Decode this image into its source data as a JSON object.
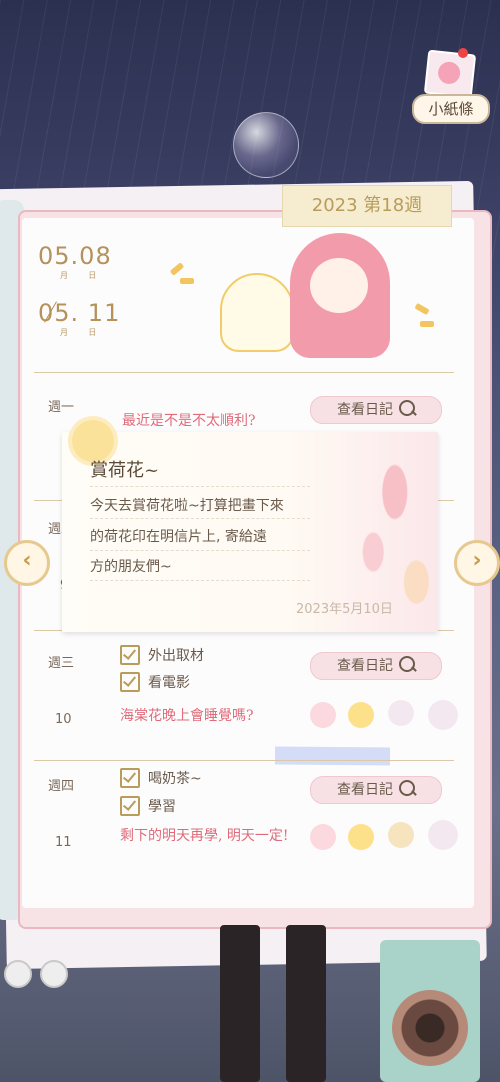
{
  "note_button": {
    "label": "小紙條"
  },
  "week": {
    "label": "2023 第18週"
  },
  "date_range": {
    "start": "05.08",
    "end": "05. 11",
    "start_sub_month": "月",
    "start_sub_day": "日",
    "end_sub_month": "月",
    "end_sub_day": "日"
  },
  "days": [
    {
      "label": "週一",
      "num": "",
      "note": "最近是不是不太順利?",
      "view_label": "查看日記"
    },
    {
      "label": "週二",
      "num": "9",
      "note": "",
      "view_label": ""
    },
    {
      "label": "週三",
      "num": "10",
      "items": [
        "外出取材",
        "看電影"
      ],
      "note": "海棠花晚上會睡覺嗎?",
      "view_label": "查看日記"
    },
    {
      "label": "週四",
      "num": "11",
      "items": [
        "喝奶茶~",
        "學習"
      ],
      "note": "剩下的明天再學, 明天一定!",
      "view_label": "查看日記"
    }
  ],
  "popup": {
    "title": "賞荷花~",
    "lines": [
      "今天去賞荷花啦~打算把畫下來",
      "的荷花印在明信片上, 寄給遠",
      "方的朋友們~"
    ],
    "date": "2023年5月10日"
  },
  "nav": {
    "prev": "‹",
    "next": "›"
  },
  "colors": {
    "accent": "#e06b7a",
    "gold": "#b4925a",
    "button_bg": "#f7e1e5"
  }
}
